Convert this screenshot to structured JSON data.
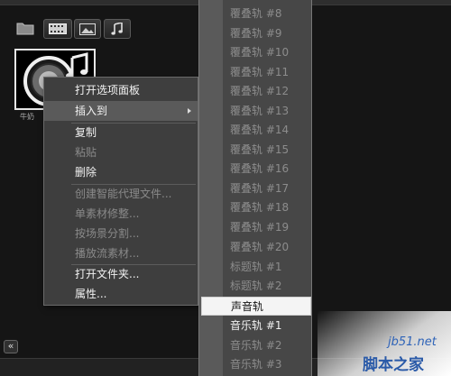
{
  "library": {
    "thumbnail_label": "牛奶"
  },
  "context_menu": {
    "items": [
      {
        "label": "打开选项面板",
        "enabled": true
      },
      {
        "label": "插入到",
        "enabled": true,
        "submenu": true,
        "highlighted": true
      },
      {
        "label": "复制",
        "enabled": true
      },
      {
        "label": "粘贴",
        "enabled": false
      },
      {
        "label": "删除",
        "enabled": true
      },
      {
        "label": "创建智能代理文件...",
        "enabled": false
      },
      {
        "label": "单素材修整...",
        "enabled": false
      },
      {
        "label": "按场景分割...",
        "enabled": false
      },
      {
        "label": "播放流素材...",
        "enabled": false
      },
      {
        "label": "打开文件夹...",
        "enabled": true
      },
      {
        "label": "属性...",
        "enabled": true
      }
    ]
  },
  "submenu": {
    "items": [
      {
        "label": "覆叠轨 #8",
        "enabled": false
      },
      {
        "label": "覆叠轨 #9",
        "enabled": false
      },
      {
        "label": "覆叠轨 #10",
        "enabled": false
      },
      {
        "label": "覆叠轨 #11",
        "enabled": false
      },
      {
        "label": "覆叠轨 #12",
        "enabled": false
      },
      {
        "label": "覆叠轨 #13",
        "enabled": false
      },
      {
        "label": "覆叠轨 #14",
        "enabled": false
      },
      {
        "label": "覆叠轨 #15",
        "enabled": false
      },
      {
        "label": "覆叠轨 #16",
        "enabled": false
      },
      {
        "label": "覆叠轨 #17",
        "enabled": false
      },
      {
        "label": "覆叠轨 #18",
        "enabled": false
      },
      {
        "label": "覆叠轨 #19",
        "enabled": false
      },
      {
        "label": "覆叠轨 #20",
        "enabled": false
      },
      {
        "label": "标题轨 #1",
        "enabled": false
      },
      {
        "label": "标题轨 #2",
        "enabled": false
      },
      {
        "label": "声音轨",
        "enabled": true,
        "highlighted": true
      },
      {
        "label": "音乐轨 #1",
        "enabled": true
      },
      {
        "label": "音乐轨 #2",
        "enabled": false
      },
      {
        "label": "音乐轨 #3",
        "enabled": false
      }
    ]
  },
  "watermark": {
    "site": "jb51.net",
    "title": "脚本之家"
  },
  "colors": {
    "menu_bg": "#3e3e3e",
    "submenu_bg": "#474747",
    "highlight_bg": "#f4f4f4",
    "disabled_text": "#8a8a8a",
    "watermark_blue": "#2a5aa8"
  }
}
